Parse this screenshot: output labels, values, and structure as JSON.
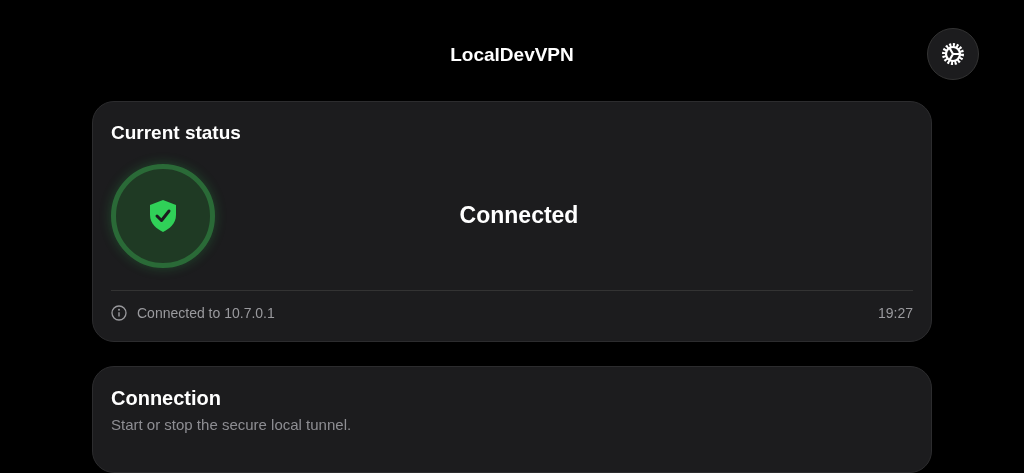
{
  "header": {
    "title": "LocalDevVPN"
  },
  "status_card": {
    "title": "Current status",
    "connected": true,
    "status_text": "Connected",
    "info": "Connected to 10.7.0.1",
    "time": "19:27"
  },
  "connection_card": {
    "title": "Connection",
    "subtitle": "Start or stop the secure local tunnel."
  }
}
